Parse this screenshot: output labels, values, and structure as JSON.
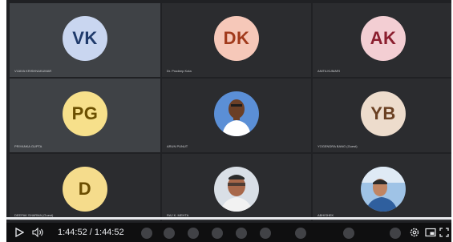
{
  "participants": [
    {
      "initials": "VK",
      "name": "VIJAYA KRISHNAKUMAR",
      "avatar_bg": "#c9d6f0",
      "text_color": "#1f3a6b",
      "tile": "light"
    },
    {
      "initials": "DK",
      "name": "Dr. Pradeep Kota",
      "avatar_bg": "#f6c8b9",
      "text_color": "#a13a1c",
      "tile": "dark"
    },
    {
      "initials": "AK",
      "name": "ANITA KUMARI",
      "avatar_bg": "#f3ced3",
      "text_color": "#8b1f2f",
      "tile": "dark"
    },
    {
      "initials": "PG",
      "name": "PRIYANKA GUPTA",
      "avatar_bg": "#f7e08b",
      "text_color": "#6b4f00",
      "tile": "light"
    },
    {
      "initials": "",
      "name": "ARUN PUNUT",
      "avatar_bg": "#5b8fd6",
      "text_color": "#ffffff",
      "tile": "dark",
      "photo": true
    },
    {
      "initials": "YB",
      "name": "YOGENDRA BANG (Guest)",
      "avatar_bg": "#eddccc",
      "text_color": "#6a4022",
      "tile": "dark"
    },
    {
      "initials": "D",
      "name": "DEEPAK SHARMA (Guest)",
      "avatar_bg": "#f5dc8c",
      "text_color": "#6a4d00",
      "tile": "dark"
    },
    {
      "initials": "",
      "name": "RAJ K. MEHTA",
      "avatar_bg": "#d9dfe6",
      "text_color": "#333333",
      "tile": "dark",
      "photo": true
    },
    {
      "initials": "",
      "name": "ABHISHEK",
      "avatar_bg": "#9fc3e6",
      "text_color": "#333333",
      "tile": "dark",
      "photo": true
    }
  ],
  "player": {
    "current_time": "1:44:52",
    "separator": "/",
    "duration": "1:44:52",
    "progress_fraction": 1.0,
    "play_icon": "play-icon",
    "volume_icon": "volume-icon",
    "settings_icon": "gear-icon",
    "miniplayer_icon": "miniplayer-icon",
    "fullscreen_icon": "fullscreen-icon"
  }
}
